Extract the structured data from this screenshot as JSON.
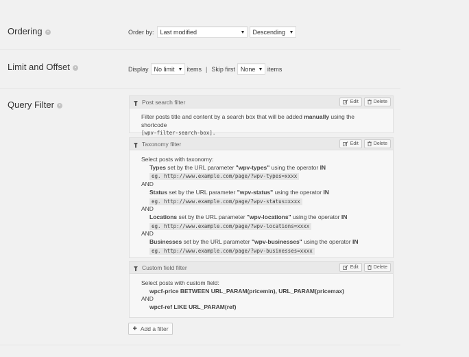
{
  "ordering": {
    "label": "Ordering",
    "order_by_label": "Order by:",
    "order_by_value": "Last modified",
    "direction_value": "Descending"
  },
  "limit": {
    "label": "Limit and Offset",
    "display_label": "Display",
    "display_value": "No limit",
    "items_label": "items",
    "separator": "|",
    "skip_label": "Skip first",
    "skip_value": "None",
    "items_label_2": "items"
  },
  "query": {
    "label": "Query Filter",
    "edit_label": "Edit",
    "delete_label": "Delete",
    "add_filter_label": "Add a filter",
    "post_search": {
      "title": "Post search filter",
      "text_pre": "Filter posts title and content by a search box that will be added ",
      "text_bold": "manually",
      "text_post": " using the shortcode",
      "shortcode": "[wpv-filter-search-box]."
    },
    "taxonomy": {
      "title": "Taxonomy filter",
      "intro": "Select posts with taxonomy:",
      "and_label": "AND",
      "set_by_text": " set by the URL parameter ",
      "operator_text": " using the operator ",
      "operator": "IN",
      "items": [
        {
          "name": "Types",
          "param": "\"wpv-types\"",
          "example": "eg. http://www.example.com/page/?wpv-types=xxxx"
        },
        {
          "name": "Status",
          "param": "\"wpv-status\"",
          "example": "eg. http://www.example.com/page/?wpv-status=xxxx"
        },
        {
          "name": "Locations",
          "param": "\"wpv-locations\"",
          "example": "eg. http://www.example.com/page/?wpv-locations=xxxx"
        },
        {
          "name": "Businesses",
          "param": "\"wpv-businesses\"",
          "example": "eg. http://www.example.com/page/?wpv-businesses=xxxx"
        }
      ]
    },
    "custom_field": {
      "title": "Custom field filter",
      "intro": "Select posts with custom field:",
      "line1": "wpcf-price BETWEEN URL_PARAM(pricemin), URL_PARAM(pricemax)",
      "and_label": "AND",
      "line2": "wpcf-ref LIKE URL_PARAM(ref)"
    }
  }
}
